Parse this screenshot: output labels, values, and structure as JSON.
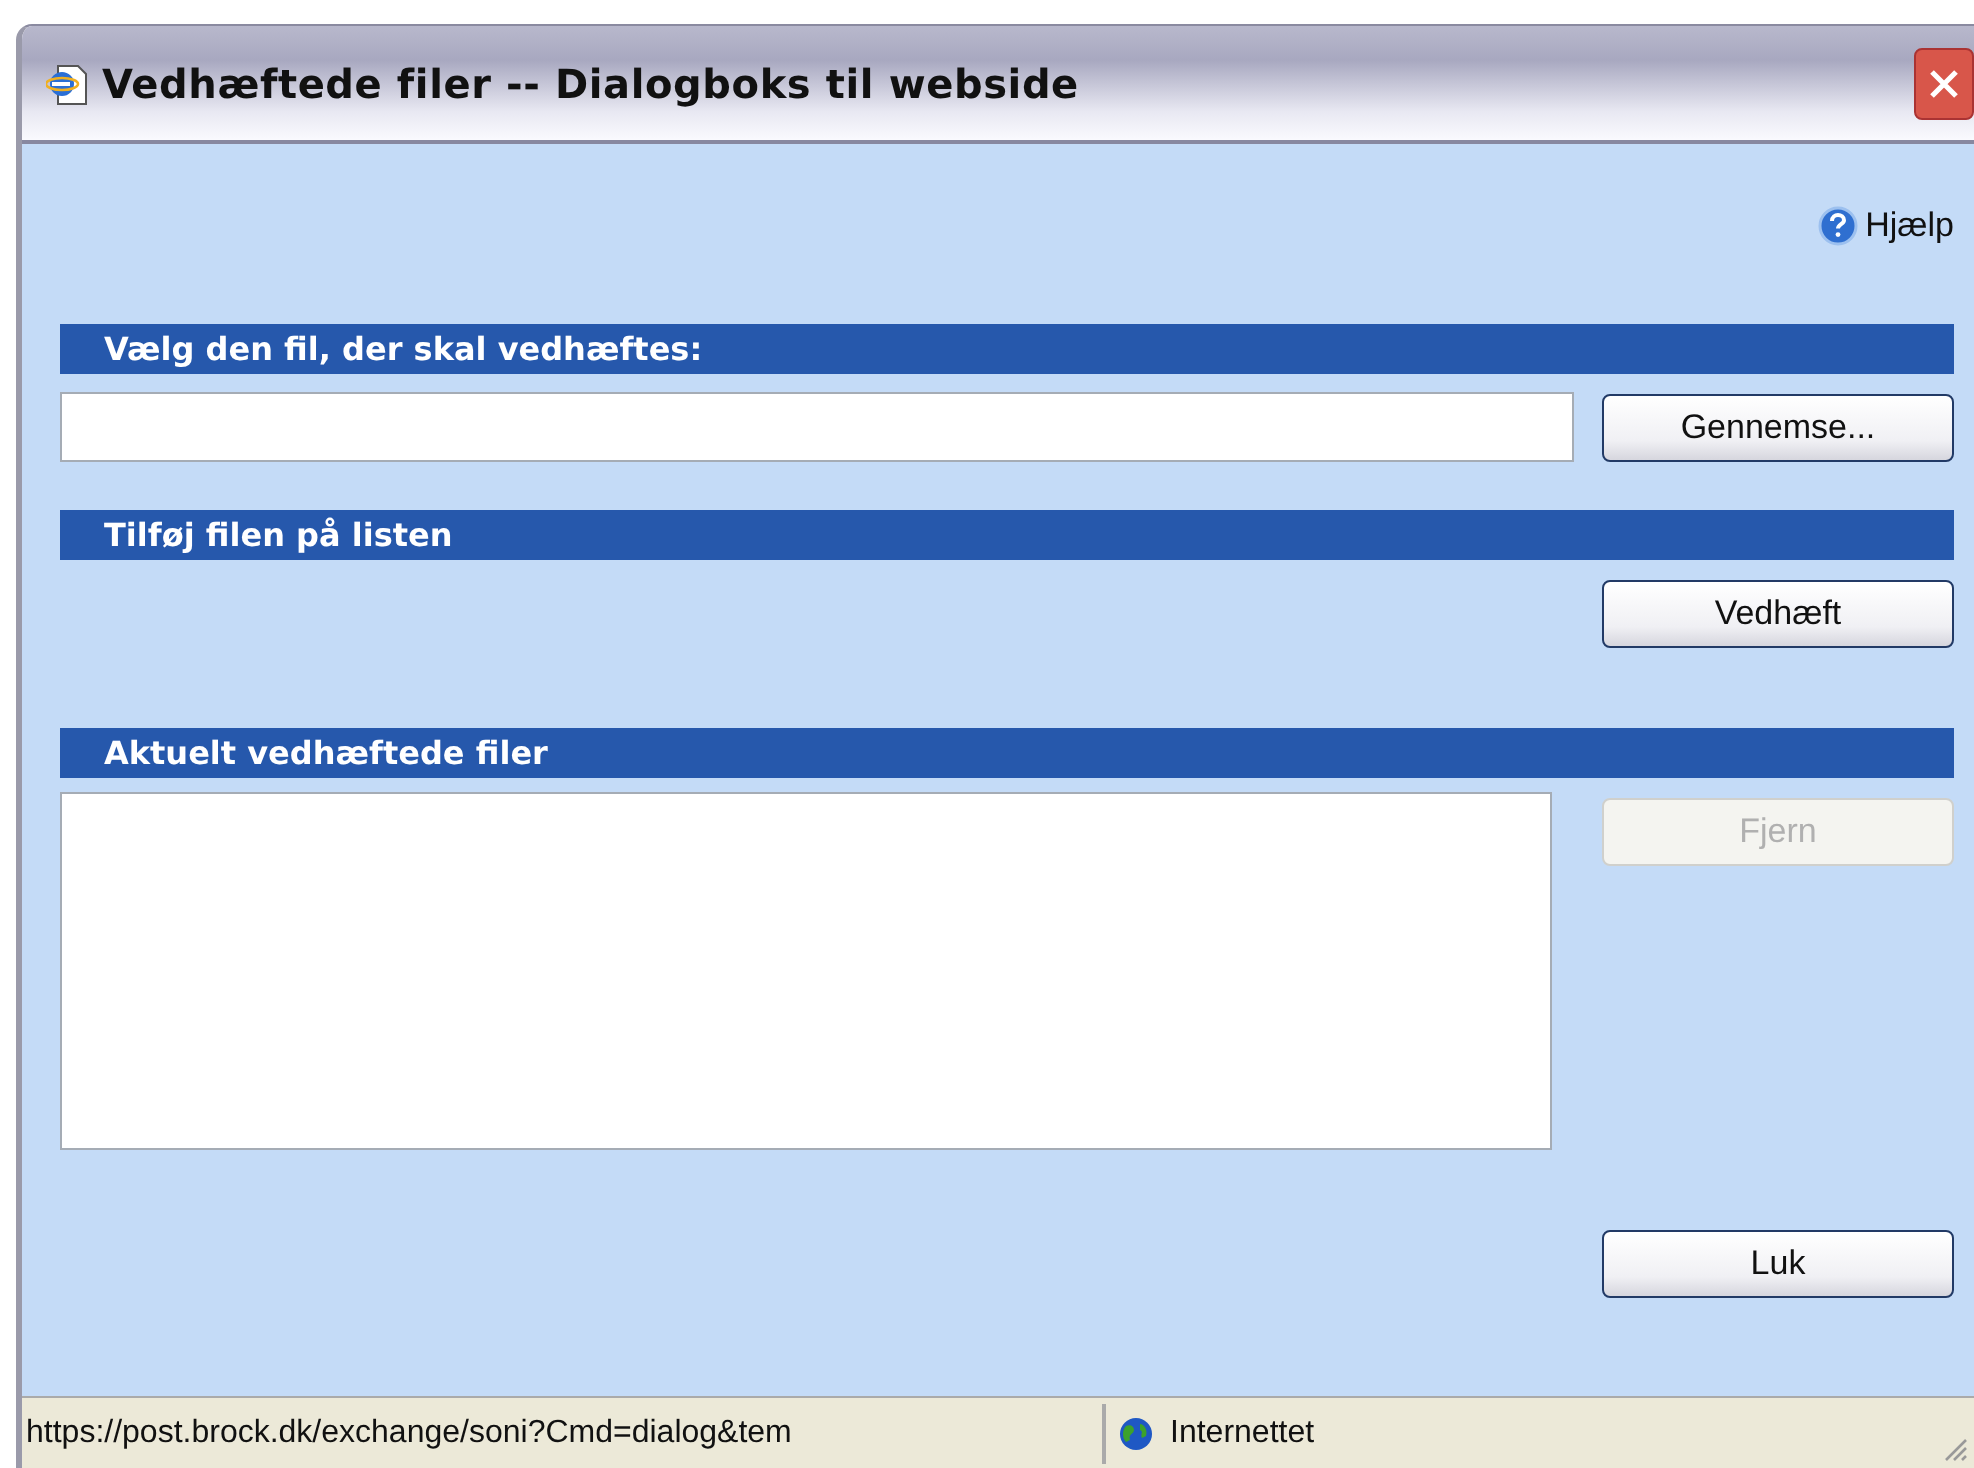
{
  "window": {
    "title": "Vedhæftede filer -- Dialogboks til webside"
  },
  "help": {
    "label": "Hjælp"
  },
  "file_section": {
    "heading": "Vælg den fil, der skal vedhæftes:",
    "button": {
      "label": "Gennemse...",
      "disabled": false
    }
  },
  "add_section": {
    "heading": "Tilføj filen på listen",
    "button": {
      "label": "Vedhæft",
      "disabled": false
    }
  },
  "attached_section": {
    "heading": "Aktuelt vedhæftede filer",
    "button": {
      "label": "Fjern",
      "disabled": true
    }
  },
  "close_button": {
    "label": "Luk",
    "disabled": false
  },
  "status_bar": {
    "url": "https://post.brock.dk/exchange/soni?Cmd=dialog&tem",
    "zone": "Internettet"
  }
}
